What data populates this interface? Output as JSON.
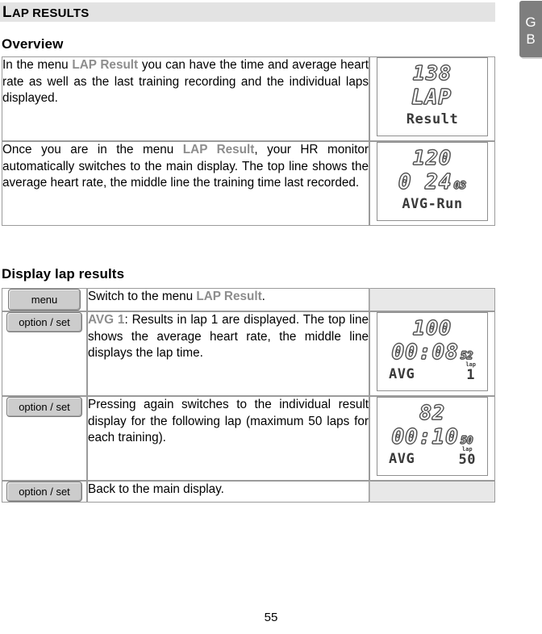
{
  "chapter": {
    "title_cap": "L",
    "title_rest": "AP RESULTS"
  },
  "language_tab": {
    "line1": "G",
    "line2": "B"
  },
  "sections": {
    "overview_heading": "Overview",
    "laps_heading": "Display lap results"
  },
  "overview": {
    "rows": [
      {
        "text_before": "In the menu ",
        "keyword": "LAP Result",
        "text_after": " you can have the time and average heart rate as well as the last training recording and the individual laps displayed.",
        "lcd": {
          "top": "138",
          "mid": "LAP",
          "mid_small": "",
          "bottom_left": "Result",
          "bottom_right": "",
          "lap_label": ""
        }
      },
      {
        "text_before": "Once you are in the menu ",
        "keyword": "LAP Result",
        "text_after": ", your HR monitor automatically switches to the main display. The top line shows the average heart rate, the middle line the training time last recorded.",
        "lcd": {
          "top": "120",
          "mid": "0 24",
          "mid_small": "03",
          "bottom_left": "AVG-Run",
          "bottom_right": "",
          "lap_label": ""
        }
      }
    ]
  },
  "laps": {
    "rows": [
      {
        "button": "menu",
        "text_before": "Switch to the menu ",
        "keyword": "LAP Result",
        "text_after": ".",
        "has_lcd": false,
        "lcd": null
      },
      {
        "button": "option / set",
        "text_before": "",
        "keyword": "AVG 1",
        "text_after": ": Results in lap 1 are displayed. The top line shows the average heart rate, the middle line displays the lap time.",
        "has_lcd": true,
        "lcd": {
          "top": "100",
          "mid": "00:08",
          "mid_small": "52",
          "bottom_left": "AVG",
          "bottom_right": "1",
          "lap_label": "lap"
        }
      },
      {
        "button": "option / set",
        "text_before": "Pressing again switches to the individual result display for the following lap (maximum 50 laps for each training).",
        "keyword": "",
        "text_after": "",
        "has_lcd": true,
        "lcd": {
          "top": "82",
          "mid": "00:10",
          "mid_small": "50",
          "bottom_left": "AVG",
          "bottom_right": "50",
          "lap_label": "lap"
        }
      },
      {
        "button": "option / set",
        "text_before": "Back to the main display.",
        "keyword": "",
        "text_after": "",
        "has_lcd": false,
        "lcd": null
      }
    ]
  },
  "footer": {
    "page_number": "55"
  }
}
